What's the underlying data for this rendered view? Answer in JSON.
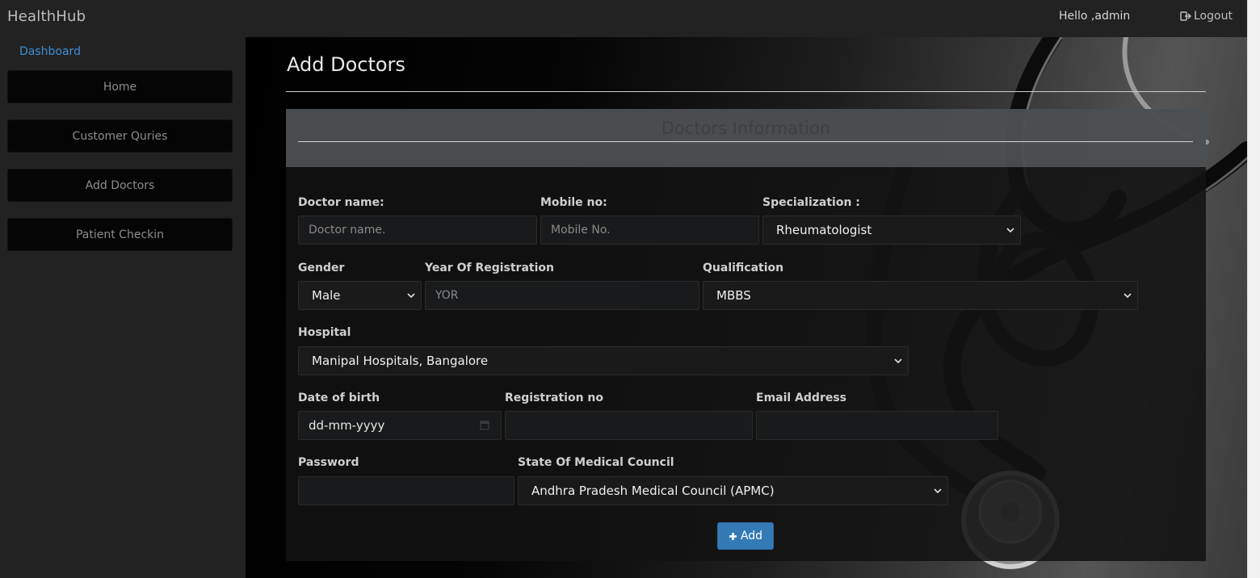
{
  "navbar": {
    "brand": "HealthHub",
    "greeting": "Hello ,admin",
    "logout_label": "Logout",
    "logout_icon": "sign-out-icon"
  },
  "sidebar": {
    "dashboard_link": "Dashboard",
    "items": [
      {
        "label": "Home"
      },
      {
        "label": "Customer Quries"
      },
      {
        "label": "Add Doctors"
      },
      {
        "label": "Patient Checkin"
      }
    ]
  },
  "main": {
    "title": "Add Doctors",
    "panel_title": "Doctors Information",
    "form": {
      "doctor_name": {
        "label": "Doctor name:",
        "placeholder": "Doctor name."
      },
      "mobile": {
        "label": "Mobile no:",
        "placeholder": "Mobile No."
      },
      "specialization": {
        "label": "Specialization :",
        "value": "Rheumatologist"
      },
      "gender": {
        "label": "Gender",
        "value": "Male"
      },
      "year_of_registration": {
        "label": "Year Of Registration",
        "placeholder": "YOR"
      },
      "qualification": {
        "label": "Qualification",
        "value": "MBBS"
      },
      "hospital": {
        "label": "Hospital",
        "value": "Manipal Hospitals, Bangalore"
      },
      "date_of_birth": {
        "label": "Date of birth",
        "value": "dd-mm-yyyy"
      },
      "registration_no": {
        "label": "Registration no",
        "value": ""
      },
      "email": {
        "label": "Email Address",
        "value": ""
      },
      "password": {
        "label": "Password",
        "value": ""
      },
      "state_council": {
        "label": "State Of Medical Council",
        "value": "Andhra Pradesh Medical Council (APMC)"
      },
      "submit_label": "Add",
      "submit_icon": "plus-icon"
    }
  },
  "colors": {
    "accent": "#337ab7",
    "link": "#3d8fd6"
  }
}
